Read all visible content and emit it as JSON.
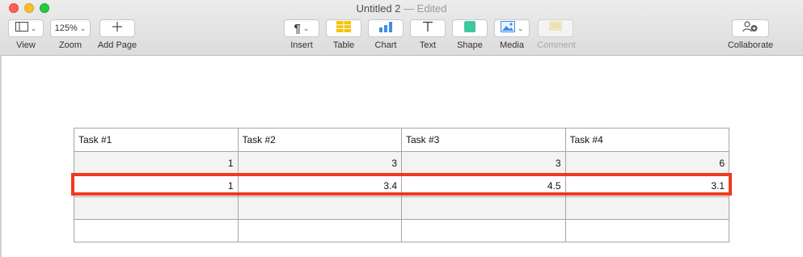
{
  "window": {
    "title": "Untitled 2",
    "title_suffix": "— Edited"
  },
  "toolbar": {
    "view": {
      "label": "View",
      "icon": "sidebar-icon"
    },
    "zoom": {
      "label": "Zoom",
      "value": "125%"
    },
    "add_page": {
      "label": "Add Page",
      "icon": "plus-icon"
    },
    "insert": {
      "label": "Insert",
      "icon": "pilcrow-icon"
    },
    "table": {
      "label": "Table",
      "icon": "table-icon"
    },
    "chart": {
      "label": "Chart",
      "icon": "bar-chart-icon"
    },
    "text": {
      "label": "Text",
      "icon": "text-T-icon"
    },
    "shape": {
      "label": "Shape",
      "icon": "shape-square-icon"
    },
    "media": {
      "label": "Media",
      "icon": "image-icon"
    },
    "comment": {
      "label": "Comment",
      "icon": "comment-icon",
      "enabled": false
    },
    "collaborate": {
      "label": "Collaborate",
      "icon": "add-person-icon"
    }
  },
  "table": {
    "headers": [
      "Task #1",
      "Task #2",
      "Task #3",
      "Task #4"
    ],
    "rows": [
      [
        "1",
        "3",
        "3",
        "6"
      ],
      [
        "1",
        "3.4",
        "4.5",
        "3.1"
      ],
      [
        "",
        "",
        "",
        ""
      ],
      [
        "",
        "",
        "",
        ""
      ]
    ],
    "highlighted_row": 1
  },
  "colors": {
    "highlight": "#f03a1d",
    "table_yellow": "#f5c400",
    "chart_blue": "#3f8ee8",
    "shape_green": "#3ec8a0"
  }
}
